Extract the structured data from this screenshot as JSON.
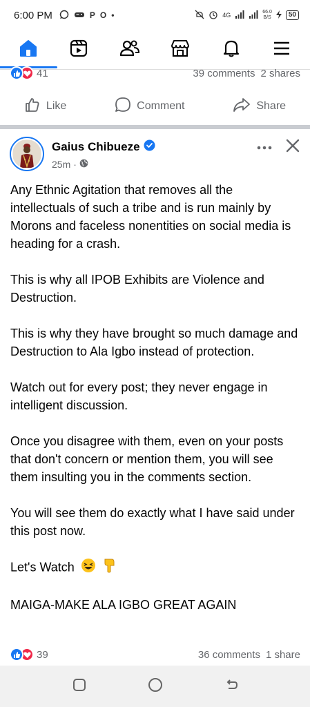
{
  "status_bar": {
    "time": "6:00 PM",
    "network": "4G",
    "speed_value": "66.0",
    "speed_unit": "B/S",
    "battery": "50"
  },
  "nav": {
    "items": [
      {
        "name": "home",
        "active": true
      },
      {
        "name": "reels"
      },
      {
        "name": "friends"
      },
      {
        "name": "marketplace"
      },
      {
        "name": "notifications"
      },
      {
        "name": "menu"
      }
    ]
  },
  "previous_post": {
    "reaction_count": "41",
    "comments": "39 comments",
    "shares": "2 shares"
  },
  "actions": {
    "like": "Like",
    "comment": "Comment",
    "share": "Share"
  },
  "post": {
    "author": "Gaius Chibueze",
    "time": "25m",
    "paragraphs": [
      "Any Ethnic Agitation that removes all the intellectuals of such a tribe and is run mainly by Morons and faceless nonentities on social media is heading for a crash.",
      "This is why all IPOB Exhibits are Violence and Destruction.",
      "This is why they have brought so much damage and Destruction to Ala Igbo instead of protection.",
      "Watch out for every post; they never engage in intelligent discussion.",
      "Once you disagree with them, even on your posts that don't concern or mention them, you will see them insulting you in the comments section.",
      "You will see them do exactly what I have said under this post now.",
      "Let's Watch",
      "MAIGA-MAKE ALA IGBO GREAT AGAIN"
    ],
    "reaction_count": "39",
    "comments": "36 comments",
    "shares": "1 share"
  },
  "colors": {
    "brand_blue": "#1877f2",
    "love_red": "#f02849",
    "secondary_text": "#65676b"
  }
}
